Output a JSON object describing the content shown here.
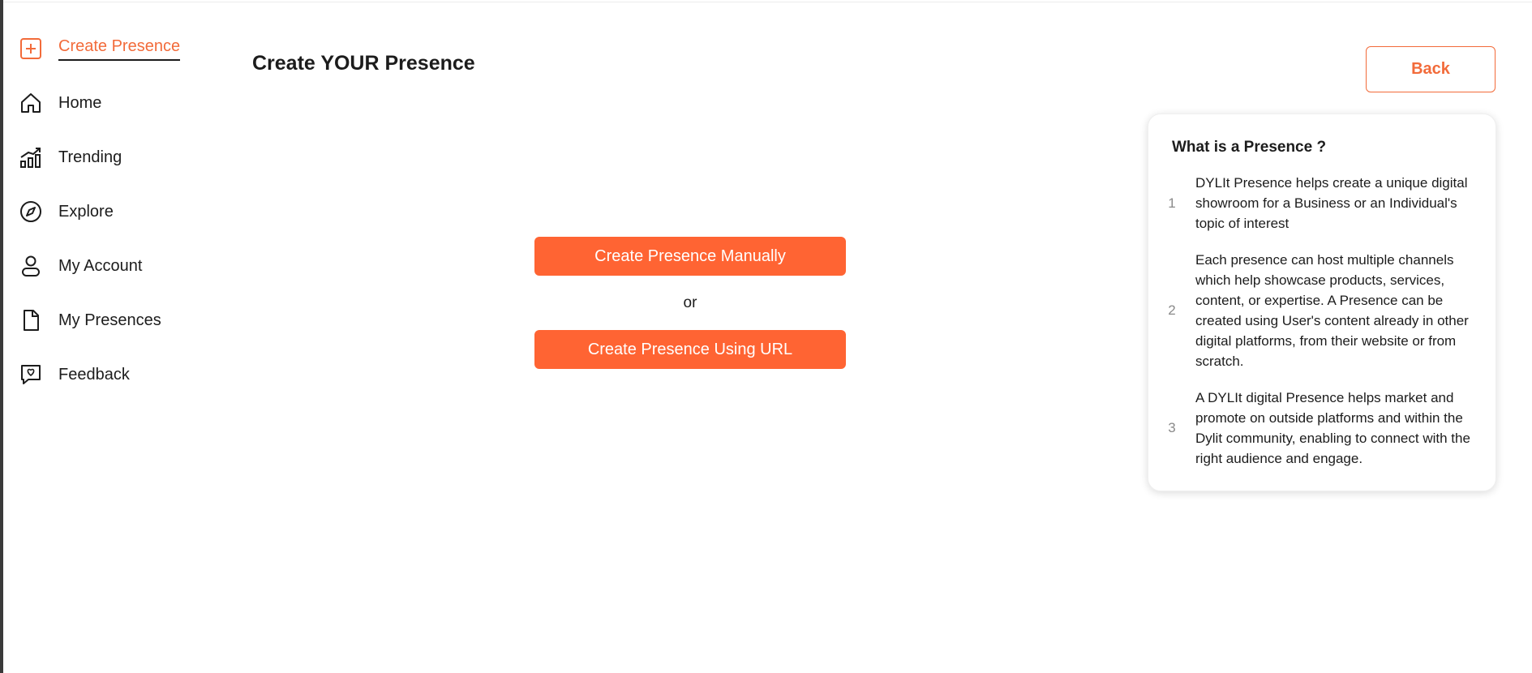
{
  "sidebar": {
    "items": [
      {
        "label": "Create Presence",
        "icon": "plus-square-icon",
        "active": true
      },
      {
        "label": "Home",
        "icon": "home-icon"
      },
      {
        "label": "Trending",
        "icon": "trending-icon"
      },
      {
        "label": "Explore",
        "icon": "compass-icon"
      },
      {
        "label": "My Account",
        "icon": "user-icon"
      },
      {
        "label": "My Presences",
        "icon": "file-icon"
      },
      {
        "label": "Feedback",
        "icon": "feedback-icon"
      }
    ]
  },
  "main": {
    "title": "Create YOUR Presence",
    "back_label": "Back",
    "manual_label": "Create Presence Manually",
    "or_label": "or",
    "url_label": "Create Presence Using URL"
  },
  "info": {
    "title": "What is a Presence ?",
    "items": [
      {
        "num": "1",
        "text": "DYLIt Presence helps create a unique digital showroom for a Business or an Individual's topic of interest"
      },
      {
        "num": "2",
        "text": "Each presence can host multiple channels which help showcase products, services, content, or expertise. A Presence can be created using User's content already in other digital platforms, from their website or from scratch."
      },
      {
        "num": "3",
        "text": "A DYLIt digital Presence helps market and promote on outside platforms and within the Dylit community, enabling to connect with the right audience and engage."
      }
    ]
  },
  "colors": {
    "accent": "#ff6433",
    "accent_text": "#f26b3a",
    "text": "#1c1c1c"
  }
}
